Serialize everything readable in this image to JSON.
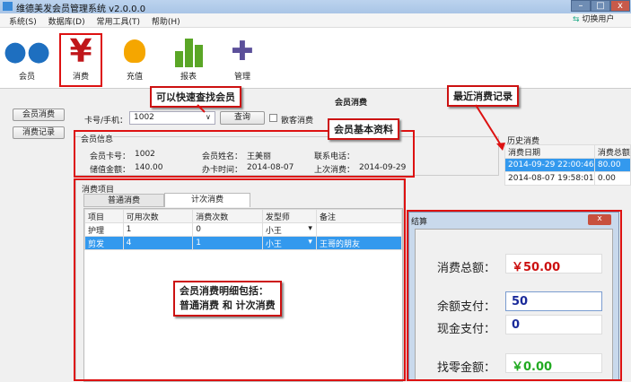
{
  "window": {
    "title": "维德美发会员管理系统 v2.0.0.0",
    "min": "–",
    "max": "□",
    "close": "x",
    "switch_user": "切换用户"
  },
  "menu": [
    "系统(S)",
    "数据库(D)",
    "常用工具(T)",
    "帮助(H)"
  ],
  "toolbar": [
    {
      "label": "会员",
      "icon": "members-icon"
    },
    {
      "label": "消费",
      "icon": "yen-icon"
    },
    {
      "label": "充值",
      "icon": "lightbulb-icon"
    },
    {
      "label": "报表",
      "icon": "bar-chart-icon"
    },
    {
      "label": "管理",
      "icon": "puzzle-icon"
    }
  ],
  "side": {
    "consume": "会员消费",
    "records": "消费记录"
  },
  "page_title": "会员消费",
  "search": {
    "label": "卡号/手机：",
    "value": "1002",
    "query": "查询",
    "walkin": "散客消费"
  },
  "member": {
    "group": "会员信息",
    "fields": [
      {
        "k": "会员卡号：",
        "v": "1002"
      },
      {
        "k": "会员姓名：",
        "v": "王美丽"
      },
      {
        "k": "联系电话：",
        "v": ""
      },
      {
        "k": "储值金额：",
        "v": "140.00"
      },
      {
        "k": "办卡时间：",
        "v": "2014-08-07"
      },
      {
        "k": "上次消费：",
        "v": "2014-09-29"
      }
    ]
  },
  "items": {
    "group": "消费项目",
    "tabs": [
      "普通消费",
      "计次消费"
    ],
    "headers": [
      "项目",
      "可用次数",
      "消费次数",
      "发型师",
      "备注"
    ],
    "rows": [
      [
        "护理",
        "1",
        "0",
        "小王",
        ""
      ],
      [
        "剪发",
        "4",
        "1",
        "小王",
        "王哥的朋友"
      ]
    ]
  },
  "history": {
    "title": "历史消费",
    "headers": [
      "消费日期",
      "消费总额"
    ],
    "rows": [
      [
        "2014-09-29 22:00:46",
        "80.00"
      ],
      [
        "2014-08-07 19:58:01",
        "0.00"
      ]
    ]
  },
  "dialog": {
    "title": "结算",
    "total_label": "消费总额：",
    "total": "￥50.00",
    "balance_label": "余额支付：",
    "balance": "50",
    "cash_label": "现金支付：",
    "cash": "0",
    "change_label": "找零金额：",
    "change": "￥0.00"
  },
  "callouts": {
    "search": "可以快速查找会员",
    "member": "会员基本资料",
    "history": "最近消费记录",
    "items1": "会员消费明细包括：",
    "items2": "普通消费 和 计次消费"
  },
  "colors": {
    "red": "#cc1111",
    "green": "#22aa22",
    "blue": "#1a2a9a",
    "select": "#3399ee"
  }
}
